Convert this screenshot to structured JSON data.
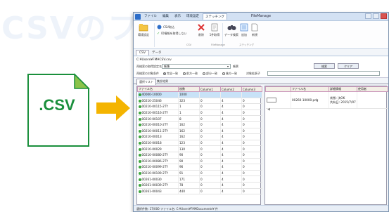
{
  "background_text": "CSVのフ",
  "csv_icon": {
    "label": ".CSV",
    "accent": "#1a8f3c",
    "fold": "#8bc34a"
  },
  "arrow": {
    "color": "#f4b400"
  },
  "window": {
    "title": "FileManage",
    "ribbon_tabs": [
      "ファイル",
      "編集",
      "表示",
      "環境設定",
      "ステッチング"
    ],
    "ribbon_active_tab": 4,
    "ribbon": {
      "big_button_1": "環境設定",
      "csv_import": "CSV取込",
      "hide_id": "ID情報を取得しない",
      "delete": "削除",
      "export": "1件取得",
      "data_search": "データ検索",
      "add": "追加",
      "new": "新規",
      "groups": [
        "CSV",
        "FileManage",
        "ステッチング"
      ]
    },
    "doc_tabs": [
      "CSV",
      "データ"
    ],
    "doc_tab_active": 0,
    "path": "C:¥Users¥FM¥CSV.csv",
    "form": {
      "lookup_label": "再検索の取得設定名",
      "lookup_value": "帳簿",
      "lookup2_label": "帳票",
      "search_button": "検索",
      "clear_button": "クリア",
      "match_label": "再検索の対象条件",
      "radio_options": [
        "完全一致",
        "前方一致",
        "部分一致",
        "後方一致"
      ],
      "radio_selected": 0,
      "target_label": "対象拡張子"
    },
    "sub_tabs": [
      "選択リスト",
      "集計結果"
    ],
    "sub_tab_active": 0,
    "left_table": {
      "headers": [
        "ファイル名",
        "枚数",
        "Column1",
        "Column2",
        "Column3"
      ],
      "rows": [
        [
          "40000-10000",
          "1000",
          "",
          "",
          ""
        ],
        [
          "00210-25046",
          "323",
          "0",
          "4",
          "0"
        ],
        [
          "00210-00115-2TY",
          "1",
          "0",
          "4",
          "0"
        ],
        [
          "00210-00116-2TY",
          "1",
          "0",
          "4",
          "0"
        ],
        [
          "00210-00107",
          "8",
          "0",
          "4",
          "0"
        ],
        [
          "00210-00010-2TY",
          "162",
          "0",
          "4",
          "0"
        ],
        [
          "00210-00011-2TY",
          "162",
          "0",
          "4",
          "0"
        ],
        [
          "00210-00013",
          "162",
          "0",
          "4",
          "0"
        ],
        [
          "00210-00018",
          "123",
          "0",
          "4",
          "0"
        ],
        [
          "00210-00029",
          "130",
          "0",
          "4",
          "0"
        ],
        [
          "00210-00080-2TY",
          "90",
          "0",
          "4",
          "0"
        ],
        [
          "00210-00086-2TY",
          "90",
          "0",
          "4",
          "0"
        ],
        [
          "00210-00099-2TY",
          "96",
          "0",
          "4",
          "0"
        ],
        [
          "00210-00109-2TY",
          "91",
          "0",
          "4",
          "0"
        ],
        [
          "00261-00030",
          "171",
          "0",
          "4",
          "0"
        ],
        [
          "00261-00039-2TY",
          "78",
          "0",
          "4",
          "0"
        ],
        [
          "00261-00043",
          "440",
          "0",
          "4",
          "0"
        ]
      ],
      "selected_row": 0
    },
    "right_table": {
      "headers": [
        "",
        "ファイル名",
        "詳細情報",
        "使用者"
      ],
      "rows": [
        [
          "",
          "00260-10000.pdg",
          "状態: 決OK\n共有日: 2015/7/07",
          ""
        ]
      ]
    },
    "status_text": "選択件数: 17/000  ファイル名: C:¥Users¥FM¥Documents¥ 件"
  }
}
